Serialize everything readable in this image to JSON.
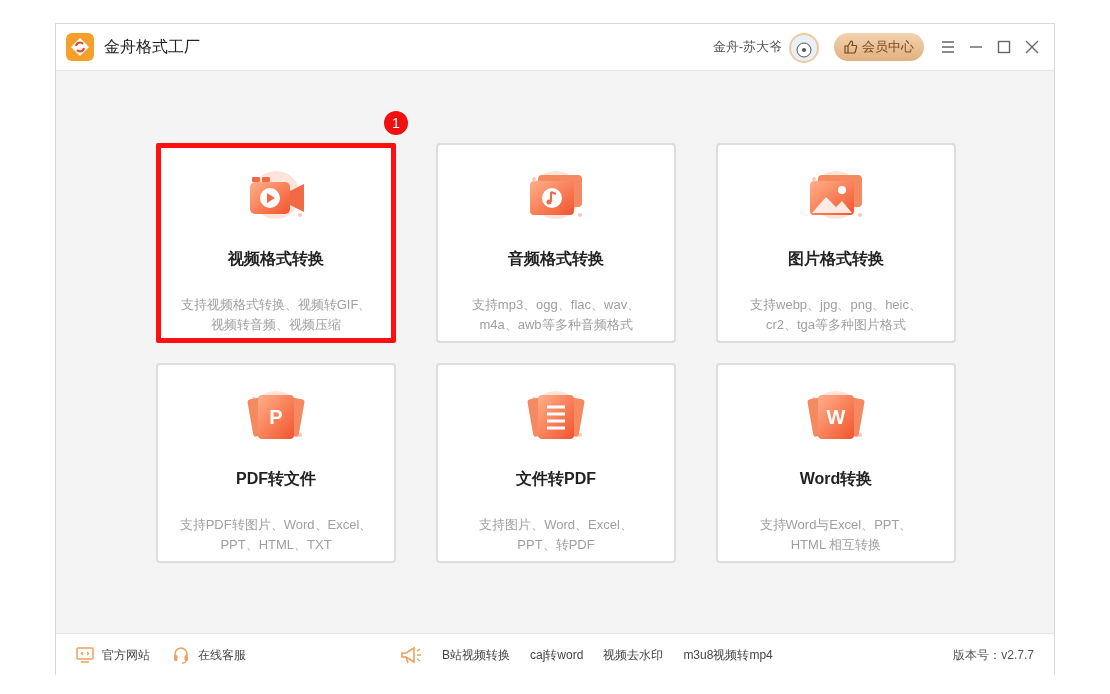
{
  "window": {
    "title": "金舟格式工厂",
    "user_name": "金舟-苏大爷",
    "vip_button": "会员中心"
  },
  "cards": [
    {
      "kind": "video",
      "title": "视频格式转换",
      "description_lines": [
        "支持视频格式转换、视频转GIF、",
        "视频转音频、视频压缩"
      ],
      "highlighted": true,
      "badge": "1"
    },
    {
      "kind": "audio",
      "title": "音频格式转换",
      "description_lines": [
        "支持mp3、ogg、flac、wav、",
        "m4a、awb等多种音频格式"
      ],
      "highlighted": false
    },
    {
      "kind": "image",
      "title": "图片格式转换",
      "description_lines": [
        "支持webp、jpg、png、heic、",
        "cr2、tga等多种图片格式"
      ],
      "highlighted": false
    },
    {
      "kind": "letter",
      "icon_letter": "P",
      "title": "PDF转文件",
      "description_lines": [
        "支持PDF转图片、Word、Excel、",
        "PPT、HTML、TXT"
      ],
      "highlighted": false
    },
    {
      "kind": "list",
      "title": "文件转PDF",
      "description_lines": [
        "支持图片、Word、Excel、",
        "PPT、转PDF"
      ],
      "highlighted": false
    },
    {
      "kind": "letter",
      "icon_letter": "W",
      "title": "Word转换",
      "description_lines": [
        "支持Word与Excel、PPT、",
        "HTML 相互转换"
      ],
      "highlighted": false
    }
  ],
  "status_bar": {
    "left_links": [
      {
        "kind": "monitor",
        "label": "官方网站"
      },
      {
        "kind": "headset",
        "label": "在线客服"
      }
    ],
    "promo_links": [
      "B站视频转换",
      "caj转word",
      "视频去水印",
      "m3u8视频转mp4"
    ],
    "version": "版本号：v2.7.7"
  }
}
